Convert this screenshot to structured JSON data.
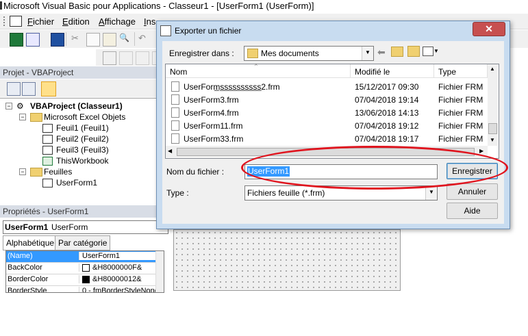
{
  "window": {
    "title": "Microsoft Visual Basic pour Applications - Classeur1 - [UserForm1 (UserForm)]"
  },
  "menu": {
    "items": [
      "Fichier",
      "Edition",
      "Affichage",
      "Ins"
    ],
    "accelerators": [
      "F",
      "E",
      "A",
      "I"
    ]
  },
  "project_panel": {
    "header": "Projet - VBAProject",
    "tree": [
      {
        "label": "VBAProject (Classeur1)",
        "level": 0,
        "bold": true,
        "icon": "vba-project-icon",
        "expander": "−"
      },
      {
        "label": "Microsoft Excel Objets",
        "level": 1,
        "icon": "folder-icon",
        "expander": "−"
      },
      {
        "label": "Feuil1 (Feuil1)",
        "level": 2,
        "icon": "sheet-icon"
      },
      {
        "label": "Feuil2 (Feuil2)",
        "level": 2,
        "icon": "sheet-icon"
      },
      {
        "label": "Feuil3 (Feuil3)",
        "level": 2,
        "icon": "sheet-icon"
      },
      {
        "label": "ThisWorkbook",
        "level": 2,
        "icon": "workbook-icon"
      },
      {
        "label": "Feuilles",
        "level": 1,
        "icon": "folder-icon",
        "expander": "−"
      },
      {
        "label": "UserForm1",
        "level": 2,
        "icon": "userform-icon"
      }
    ]
  },
  "properties_panel": {
    "header": "Propriétés - UserForm1",
    "object_name": "UserForm1",
    "object_type": "UserForm",
    "tabs": [
      "Alphabétique",
      "Par catégorie"
    ],
    "rows": [
      {
        "name": "(Name)",
        "value": "UserForm1",
        "selected": true
      },
      {
        "name": "BackColor",
        "value": "&H8000000F&",
        "swatch": "#ffffff"
      },
      {
        "name": "BorderColor",
        "value": "&H80000012&",
        "swatch": "#000000"
      },
      {
        "name": "BorderStyle",
        "value": "0 - fmBorderStyleNone"
      }
    ]
  },
  "dialog": {
    "title": "Exporter un fichier",
    "close_glyph": "✕",
    "save_in_label": "Enregistrer dans :",
    "save_in_value": "Mes documents",
    "columns": {
      "name": "Nom",
      "modified": "Modifié le",
      "type": "Type"
    },
    "files": [
      {
        "name": "UserForm̲s̲s̲s̲s̲s̲s̲s̲s̲s̲s̲2.frm",
        "modified": "15/12/2017 09:30",
        "type": "Fichier FRM"
      },
      {
        "name": "UserForm3.frm",
        "modified": "07/04/2018 19:14",
        "type": "Fichier FRM"
      },
      {
        "name": "UserForm4.frm",
        "modified": "13/06/2018 14:13",
        "type": "Fichier FRM"
      },
      {
        "name": "UserForm11.frm",
        "modified": "07/04/2018 19:12",
        "type": "Fichier FRM"
      },
      {
        "name": "UserForm33.frm",
        "modified": "07/04/2018 19:17",
        "type": "Fichier FRM"
      }
    ],
    "filename_label": "Nom du fichier :",
    "filename_value": "UserForm1",
    "type_label": "Type :",
    "type_value": "Fichiers feuille (*.frm)",
    "buttons": {
      "save": "Enregistrer",
      "cancel": "Annuler",
      "help": "Aide"
    }
  },
  "annotation": {
    "color": "#e0141e"
  }
}
